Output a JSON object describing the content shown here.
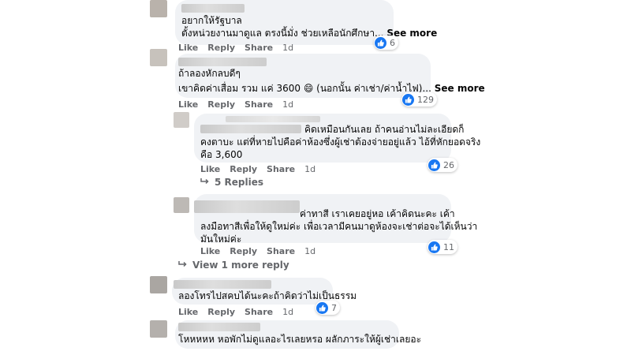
{
  "comments": [
    {
      "text_lines": [
        "อยากให้รัฐบาล",
        "ตั้งหน่วยงานมาดูแล ตรงนี้มั่ง ช่วยเหลือนักศึกษา..."
      ],
      "see_more": "See more",
      "reactions": "6",
      "actions": {
        "like": "Like",
        "reply": "Reply",
        "share": "Share",
        "time": "1d"
      }
    },
    {
      "text_lines": [
        "ถ้าลองหักลบดีๆ",
        "เขาคิดค่าเสื่อม รวม แค่ 3600 😄 (นอกนั้น ค่าเช่า/ค่าน้ำไฟ)..."
      ],
      "see_more": "See more",
      "reactions": "129",
      "actions": {
        "like": "Like",
        "reply": "Reply",
        "share": "Share",
        "time": "1d"
      }
    },
    {
      "text_lines": [
        "คิดเหมือนกันเลย ถ้าคนอ่านไม่ละเอียดก็",
        "คงตาบะ แต่ที่หายไปคือค่าห้องซึ่งผู้เช่าต้องจ่ายอยู่แล้ว ไอ้ที่หักยอดจริง",
        "คือ 3,600"
      ],
      "reactions": "26",
      "actions": {
        "like": "Like",
        "reply": "Reply",
        "share": "Share",
        "time": "1d"
      },
      "replies_link": "5 Replies"
    },
    {
      "text_lines": [
        "ค่าทาสี เราเคยอยู่หอ เค้าคิดนะคะ เค้า",
        "ลงมือทาสีเพื่อให้ดูใหม่ค่ะ เพื่อเวลามีคนมาดูห้องจะเช่าต่อจะได้เห็นว่า",
        "มันใหม่ค่ะ"
      ],
      "reactions": "11",
      "actions": {
        "like": "Like",
        "reply": "Reply",
        "share": "Share",
        "time": "1d"
      },
      "replies_link": "View 1 more reply"
    },
    {
      "text_lines": [
        "ลองโทรไปสคบได้นะคะถ้าคิดว่าไม่เป็นธรรม"
      ],
      "reactions": "7",
      "actions": {
        "like": "Like",
        "reply": "Reply",
        "share": "Share",
        "time": "1d"
      }
    },
    {
      "text_lines": [
        "โหหหหห หอพักไม่ดูแลอะไรเลยหรอ ผลักภาระให้ผู้เช่าเลยอะ"
      ]
    }
  ],
  "icons": {
    "reaction": "like-icon",
    "reply_arrow": "reply-arrow-icon"
  },
  "colors": {
    "like_blue": "#1877f2",
    "bubble": "#f0f2f5",
    "meta_gray": "#65676b"
  }
}
